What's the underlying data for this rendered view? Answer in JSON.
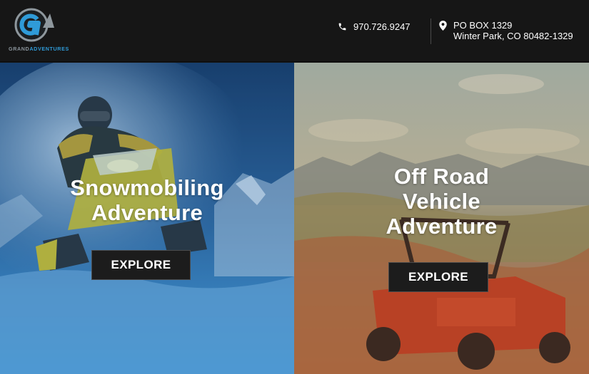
{
  "brand": {
    "logo_text_left": "GRAND",
    "logo_text_right": "ADVENTURES",
    "accent_color": "#2f9bd8"
  },
  "contact": {
    "phone_icon": "phone-icon",
    "phone": "970.726.9247",
    "location_icon": "map-marker-icon",
    "address_line1": "PO BOX 1329",
    "address_line2": "Winter Park, CO 80482-1329"
  },
  "panels": [
    {
      "title_line1": "Snowmobiling",
      "title_line2": "Adventure",
      "button_label": "EXPLORE",
      "tint": "#1f6fb0"
    },
    {
      "title_line1": "Off Road",
      "title_line2": "Vehicle",
      "title_line3": "Adventure",
      "button_label": "EXPLORE",
      "tint": "#c0572a"
    }
  ]
}
